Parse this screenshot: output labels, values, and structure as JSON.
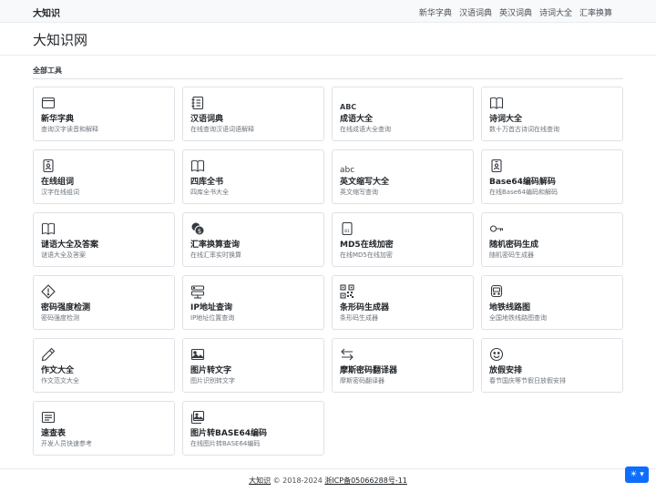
{
  "brand": "大知识",
  "nav": [
    "新华字典",
    "汉语词典",
    "英汉词典",
    "诗词大全",
    "汇率换算"
  ],
  "page_title": "大知识网",
  "section_title": "全部工具",
  "tools": [
    {
      "icon": "window-icon",
      "title": "新华字典",
      "desc": "查询汉字读音和解释"
    },
    {
      "icon": "journal-icon",
      "title": "汉语词典",
      "desc": "在线查询汉语词语解释"
    },
    {
      "icon": "abc-icon",
      "title": "成语大全",
      "desc": "在线成语大全查询"
    },
    {
      "icon": "book-icon",
      "title": "诗词大全",
      "desc": "数十万首古诗词在线查询"
    },
    {
      "icon": "person-badge-icon",
      "title": "在线组词",
      "desc": "汉字在线组词"
    },
    {
      "icon": "book-icon",
      "title": "四库全书",
      "desc": "四库全书大全"
    },
    {
      "icon": "abc-lower-icon",
      "title": "英文缩写大全",
      "desc": "英文缩写查询"
    },
    {
      "icon": "person-badge-icon",
      "title": "Base64编码解码",
      "desc": "在线Base64编码和解码"
    },
    {
      "icon": "book-icon",
      "title": "谜语大全及答案",
      "desc": "谜语大全及答案"
    },
    {
      "icon": "coin-exchange-icon",
      "title": "汇率换算查询",
      "desc": "在线汇率实时换算"
    },
    {
      "icon": "binary-file-icon",
      "title": "MD5在线加密",
      "desc": "在线MD5在线加密"
    },
    {
      "icon": "key-icon",
      "title": "随机密码生成",
      "desc": "随机密码生成器"
    },
    {
      "icon": "warning-icon",
      "title": "密码强度检测",
      "desc": "密码强度检测"
    },
    {
      "icon": "server-icon",
      "title": "IP地址查询",
      "desc": "IP地址位置查询"
    },
    {
      "icon": "qr-code-icon",
      "title": "条形码生成器",
      "desc": "条形码生成器"
    },
    {
      "icon": "train-icon",
      "title": "地铁线路图",
      "desc": "全国地铁线路图查询"
    },
    {
      "icon": "pencil-icon",
      "title": "作文大全",
      "desc": "作文范文大全"
    },
    {
      "icon": "image-icon",
      "title": "图片转文字",
      "desc": "图片识别转文字"
    },
    {
      "icon": "arrows-exchange-icon",
      "title": "摩斯密码翻译器",
      "desc": "摩斯密码翻译器"
    },
    {
      "icon": "smile-icon",
      "title": "放假安排",
      "desc": "春节国庆等节假日放假安排"
    },
    {
      "icon": "card-text-icon",
      "title": "速查表",
      "desc": "开发人员快速参考"
    },
    {
      "icon": "images-icon",
      "title": "图片转BASE64编码",
      "desc": "在线图片转BASE64编码"
    }
  ],
  "footer": {
    "site": "大知识",
    "copyright": " © 2018-2024 ",
    "icp": "浙ICP备05066288号-11"
  },
  "theme_toggle": "☀ ▾"
}
